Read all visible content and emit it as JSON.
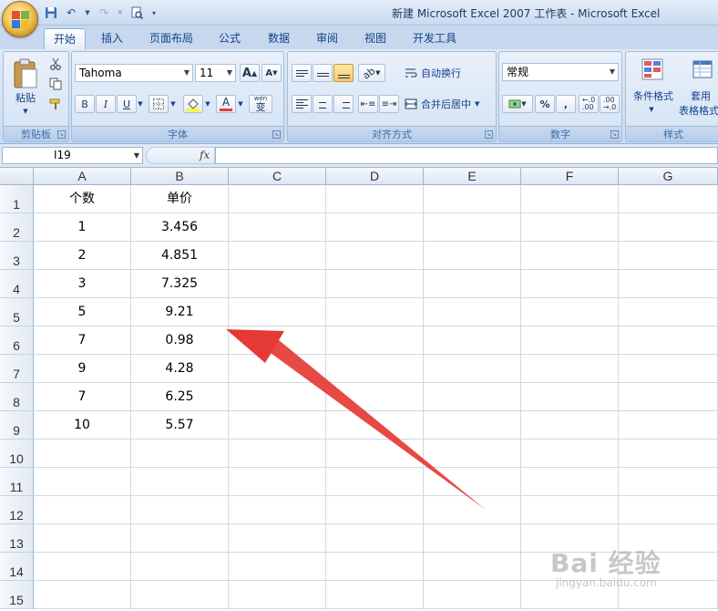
{
  "window": {
    "title": "新建 Microsoft Excel 2007 工作表 - Microsoft Excel"
  },
  "ribbon_tabs": [
    "开始",
    "插入",
    "页面布局",
    "公式",
    "数据",
    "审阅",
    "视图",
    "开发工具"
  ],
  "ribbon": {
    "clipboard": {
      "paste_label": "粘贴",
      "group_label": "剪贴板"
    },
    "font": {
      "font_name": "Tahoma",
      "font_size": "11",
      "grow_glyph": "A",
      "shrink_glyph": "A",
      "bold": "B",
      "italic": "I",
      "underline": "U",
      "font_color_glyph": "A",
      "phonetic_glyph": "wén",
      "phonetic_char": "变",
      "group_label": "字体"
    },
    "alignment": {
      "wrap_text": "自动换行",
      "merge_center": "合并后居中",
      "group_label": "对齐方式"
    },
    "number": {
      "format": "常规",
      "percent": "%",
      "comma": ",",
      "group_label": "数字"
    },
    "styles": {
      "conditional_format": "条件格式",
      "table_format_line1": "套用",
      "table_format_line2": "表格格式",
      "group_label": "样式"
    }
  },
  "formula_bar": {
    "name_box": "I19",
    "fx": "fx",
    "formula": ""
  },
  "sheet": {
    "columns": [
      "A",
      "B",
      "C",
      "D",
      "E",
      "F",
      "G"
    ],
    "rows": [
      "1",
      "2",
      "3",
      "4",
      "5",
      "6",
      "7",
      "8",
      "9",
      "10",
      "11",
      "12",
      "13",
      "14",
      "15"
    ],
    "data": [
      [
        "个数",
        "单价"
      ],
      [
        "1",
        "3.456"
      ],
      [
        "2",
        "4.851"
      ],
      [
        "3",
        "7.325"
      ],
      [
        "5",
        "9.21"
      ],
      [
        "7",
        "0.98"
      ],
      [
        "9",
        "4.28"
      ],
      [
        "7",
        "6.25"
      ],
      [
        "10",
        "5.57"
      ]
    ]
  },
  "colors": {
    "arrow": "#e53935",
    "ribbon_text": "#15428b"
  },
  "watermark": {
    "brand": "Bai 经验",
    "url": "jingyan.baidu.com"
  }
}
